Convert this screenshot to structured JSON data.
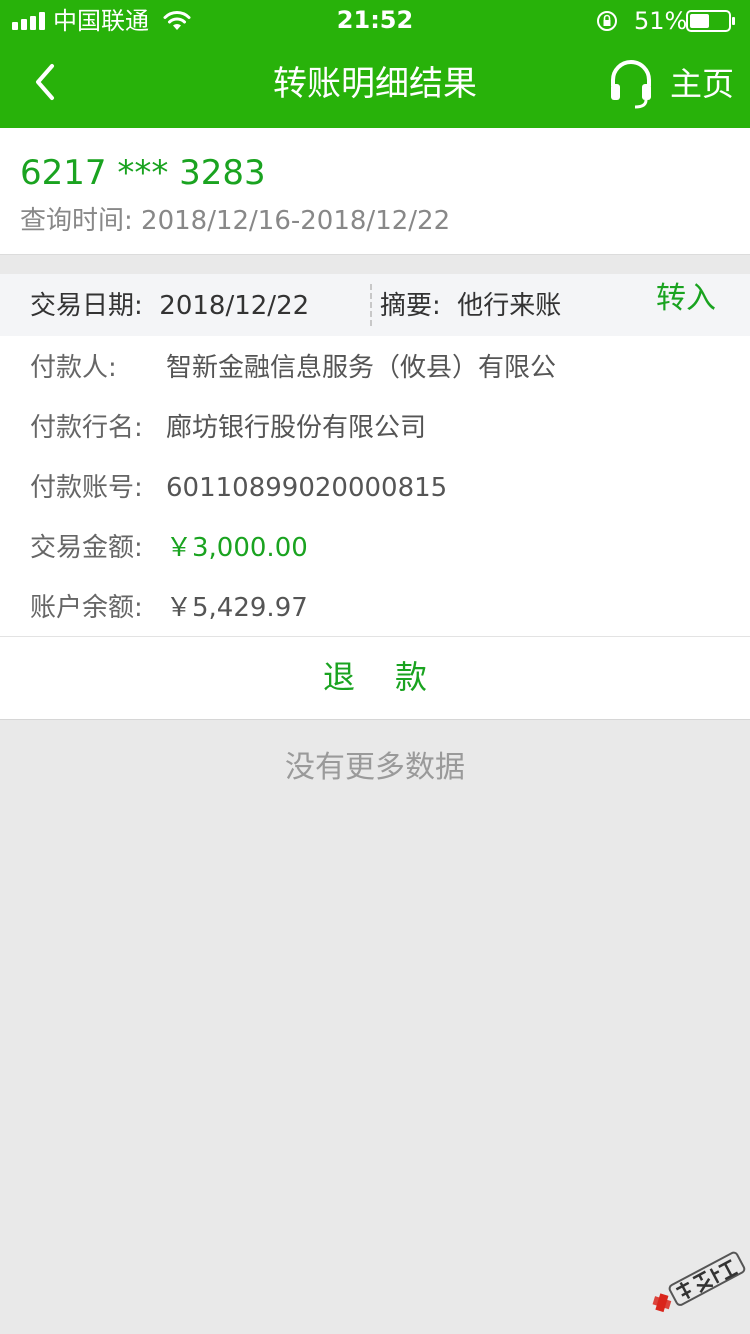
{
  "status_bar": {
    "carrier": "中国联通",
    "time": "21:52",
    "battery_percent": "51%",
    "battery_level": 0.51,
    "signal_bars": 4
  },
  "nav": {
    "title": "转账明细结果",
    "home_label": "主页",
    "back_icon": "chevron-left-icon",
    "service_icon": "headset-icon"
  },
  "account": {
    "number": "6217 *** 3283",
    "query_range": "查询时间: 2018/12/16-2018/12/22"
  },
  "transaction": {
    "date_label": "交易日期:",
    "date": "2018/12/22",
    "summary_label": "摘要:",
    "summary": "他行来账",
    "direction": "转入",
    "rows": [
      {
        "label": "付款人:",
        "value": "智新金融信息服务（攸县）有限公"
      },
      {
        "label": "付款行名:",
        "value": "廊坊银行股份有限公司"
      },
      {
        "label": "付款账号:",
        "value": "60110899020000815"
      },
      {
        "label": "交易金额:",
        "value": "￥3,000.00"
      },
      {
        "label": "账户余额:",
        "value": "￥5,429.97"
      }
    ],
    "refund_label": "退款"
  },
  "footer": {
    "no_more": "没有更多数据"
  },
  "watermark": {
    "text": "卡农社区"
  },
  "colors": {
    "brand_green": "#28b20a",
    "accent_green": "#1aa320",
    "background_gray": "#e9e9e9"
  }
}
